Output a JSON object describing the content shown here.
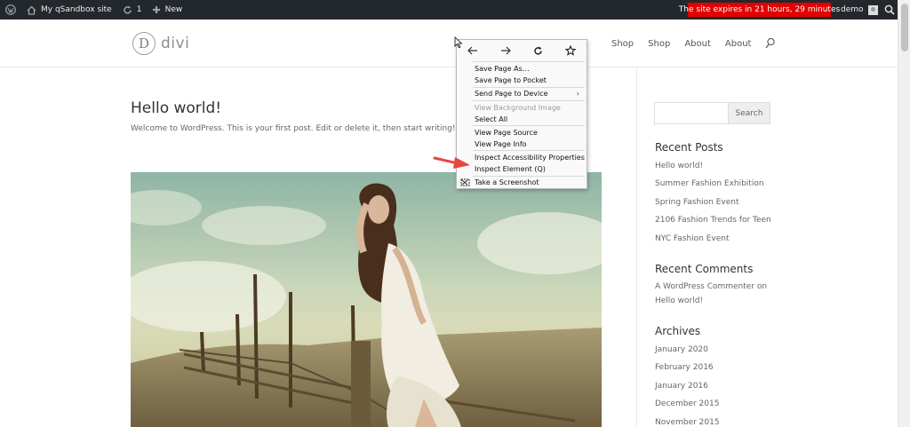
{
  "admin_bar": {
    "site_name": "My qSandbox site",
    "updates_count": "1",
    "new_label": "New",
    "expires_text": "The site expires in  21 hours, 29 minutes",
    "user": "demo"
  },
  "header": {
    "logo_mark": "D",
    "logo_text": "divi",
    "nav": [
      "Shop",
      "Shop",
      "About",
      "About"
    ]
  },
  "post": {
    "title": "Hello world!",
    "excerpt": "Welcome to WordPress. This is your first post. Edit or delete it, then start writing!"
  },
  "sidebar": {
    "search_button": "Search",
    "recent_posts_heading": "Recent Posts",
    "recent_posts": [
      "Hello world!",
      "Summer Fashion Exhibition",
      "Spring Fashion Event",
      "2106 Fashion Trends for Teen",
      "NYC Fashion Event"
    ],
    "recent_comments_heading": "Recent Comments",
    "recent_comment_line1": "A WordPress Commenter on",
    "recent_comment_line2": "Hello world!",
    "archives_heading": "Archives",
    "archives": [
      "January 2020",
      "February 2016",
      "January 2016",
      "December 2015",
      "November 2015"
    ]
  },
  "context_menu": {
    "save_page_as": "Save Page As…",
    "save_to_pocket": "Save Page to Pocket",
    "send_to_device": "Send Page to Device",
    "view_bg_image": "View Background Image",
    "select_all": "Select All",
    "view_source": "View Page Source",
    "view_info": "View Page Info",
    "inspect_accessibility": "Inspect Accessibility Properties",
    "inspect_element": "Inspect Element (Q)",
    "take_screenshot": "Take a Screenshot"
  },
  "colors": {
    "admin_bar": "#23282d",
    "expires_bg": "#e20000",
    "arrow": "#e8453c"
  }
}
